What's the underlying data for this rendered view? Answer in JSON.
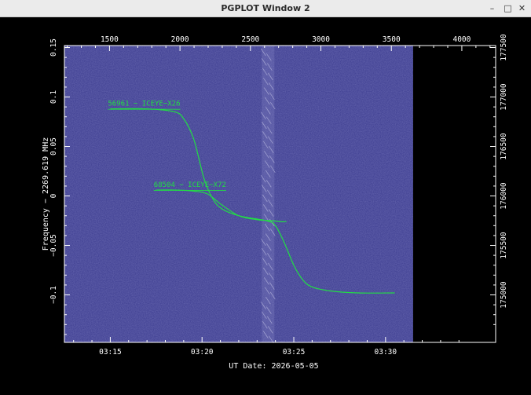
{
  "window": {
    "title": "PGPLOT Window 2",
    "minimize_glyph": "–",
    "maximize_glyph": "□",
    "close_glyph": "✕"
  },
  "plot": {
    "xlabel": "UT Date: 2026-05-05",
    "ylabel": "Frequency − 2269.619 MHz",
    "colors": {
      "background": "#3a3a8e",
      "axis": "#ffffff",
      "curve": "#22dd44"
    }
  },
  "chart_data": {
    "type": "line",
    "x_axis_bottom": {
      "ticks": [
        "03:15",
        "03:20",
        "03:25",
        "03:30"
      ],
      "values_min": [
        15,
        20,
        25,
        30
      ],
      "range_min": [
        12.5,
        36.0
      ]
    },
    "x_axis_top": {
      "ticks": [
        "1500",
        "2000",
        "2500",
        "3000",
        "3500",
        "4000"
      ],
      "values": [
        1500,
        2000,
        2500,
        3000,
        3500,
        4000
      ],
      "range": [
        1180,
        4240
      ]
    },
    "y_axis_left": {
      "ticks": [
        "0.15",
        "0.1",
        "0.05",
        "0",
        "−0.05",
        "−0.1"
      ],
      "values": [
        0.15,
        0.1,
        0.05,
        0,
        -0.05,
        -0.1
      ],
      "range": [
        -0.148,
        0.152
      ]
    },
    "y_axis_right": {
      "ticks": [
        "177500",
        "177000",
        "176500",
        "176000",
        "175500",
        "175000"
      ],
      "values": [
        177500,
        177000,
        176500,
        176000,
        175500,
        175000
      ]
    },
    "series": [
      {
        "name": "56961 − ICEYE−X26",
        "x": [
          15.0,
          17.0,
          18.5,
          19.0,
          19.5,
          19.8,
          20.1,
          20.5,
          21.0,
          22.0,
          23.5,
          24.0,
          24.5,
          25.0,
          25.5,
          26.0,
          27.0,
          28.5,
          30.5
        ],
        "y": [
          0.088,
          0.088,
          0.085,
          0.078,
          0.06,
          0.04,
          0.018,
          0.0,
          -0.012,
          -0.02,
          -0.025,
          -0.03,
          -0.048,
          -0.07,
          -0.085,
          -0.092,
          -0.096,
          -0.098,
          -0.098
        ]
      },
      {
        "name": "68504 − ICEYE−X72",
        "x": [
          17.5,
          18.5,
          19.5,
          20.3,
          21.0,
          22.0,
          23.0,
          23.8,
          24.3,
          24.6
        ],
        "y": [
          0.006,
          0.006,
          0.005,
          0.002,
          -0.008,
          -0.02,
          -0.024,
          -0.025,
          -0.026,
          -0.026
        ]
      }
    ],
    "waterfall_extent_min": [
      12.5,
      31.5
    ]
  }
}
